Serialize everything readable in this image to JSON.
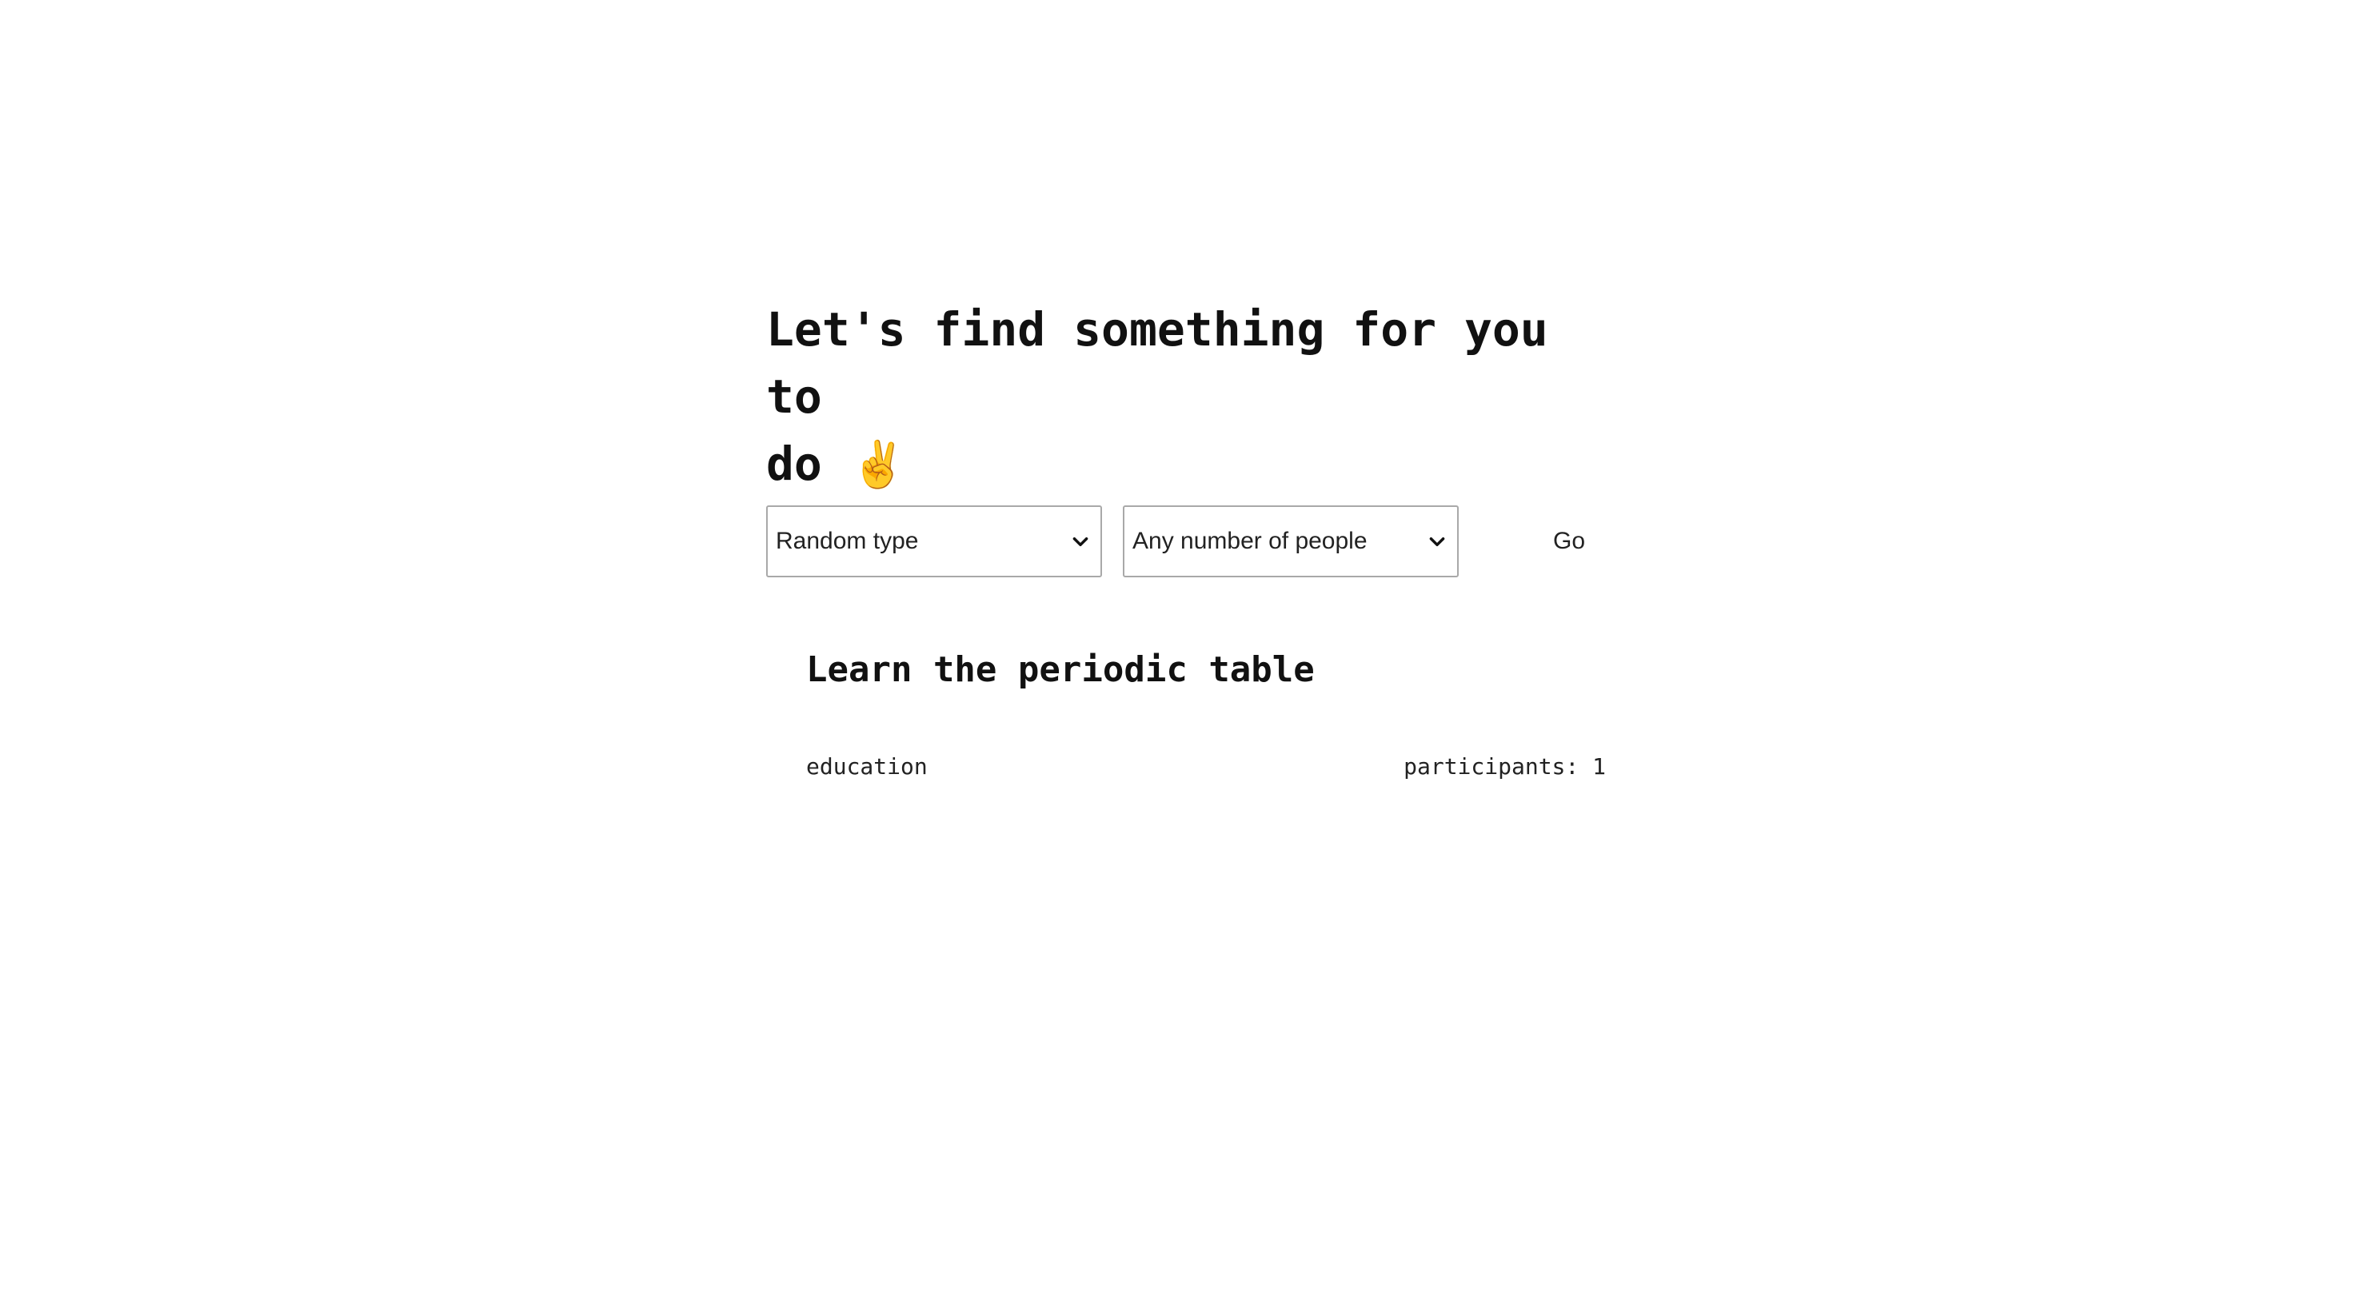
{
  "header": {
    "title": "Let's find something for you to do",
    "emoji": "✌️"
  },
  "filters": {
    "type_select": {
      "selected": "Random type",
      "icon": "chevron-down-icon"
    },
    "participants_select": {
      "selected": "Any number of people",
      "icon": "chevron-down-icon"
    },
    "go_label": "Go"
  },
  "activity": {
    "title": "Learn the periodic table",
    "type": "education",
    "participants_label": "participants: 1"
  },
  "colors": {
    "text": "#111111",
    "border": "#a9a9a9",
    "emoji": "#f2e21a",
    "background": "#ffffff"
  }
}
